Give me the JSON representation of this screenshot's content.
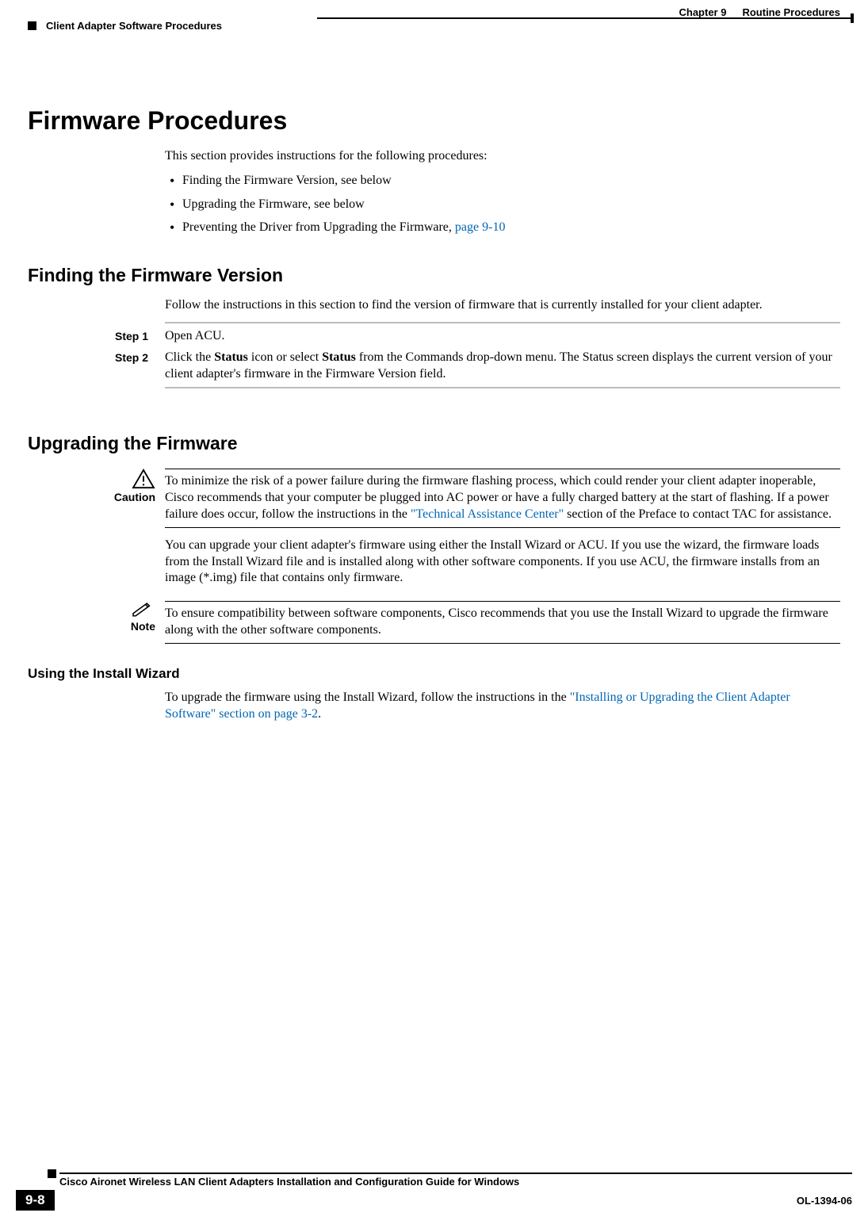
{
  "header": {
    "chapter": "Chapter 9",
    "title": "Routine Procedures",
    "section": "Client Adapter Software Procedures"
  },
  "main": {
    "h1": "Firmware Procedures",
    "intro": "This section provides instructions for the following procedures:",
    "bullets": [
      {
        "text": "Finding the Firmware Version, see below",
        "link": ""
      },
      {
        "text": "Upgrading the Firmware, see below",
        "link": ""
      },
      {
        "text": "Preventing the Driver from Upgrading the Firmware, ",
        "link": "page 9-10"
      }
    ],
    "finding": {
      "heading": "Finding the Firmware Version",
      "intro": "Follow the instructions in this section to find the version of firmware that is currently installed for your client adapter.",
      "steps": [
        {
          "label": "Step 1",
          "html": "Open ACU."
        },
        {
          "label": "Step 2",
          "html": "Click the <b>Status</b> icon or select <b>Status</b> from the Commands drop-down menu. The Status screen displays the current version of your client adapter's firmware in the Firmware Version field."
        }
      ]
    },
    "upgrading": {
      "heading": "Upgrading the Firmware",
      "caution_label": "Caution",
      "caution_text_before": "To minimize the risk of a power failure during the firmware flashing process, which could render your client adapter inoperable, Cisco recommends that your computer be plugged into AC power or have a fully charged battery at the start of flashing. If a power failure does occur, follow the instructions in the ",
      "caution_link": "\"Technical Assistance Center\"",
      "caution_text_after": " section of the Preface to contact TAC for assistance.",
      "para": "You can upgrade your client adapter's firmware using either the Install Wizard or ACU. If you use the wizard, the firmware loads from the Install Wizard file and is installed along with other software components. If you use ACU, the firmware installs from an image (*.img) file that contains only firmware.",
      "note_label": "Note",
      "note_text": "To ensure compatibility between software components, Cisco recommends that you use the Install Wizard to upgrade the firmware along with the other software components.",
      "using_wizard_heading": "Using the Install Wizard",
      "using_wizard_before": "To upgrade the firmware using the Install Wizard, follow the instructions in the ",
      "using_wizard_link": "\"Installing or Upgrading the Client Adapter Software\" section on page 3-2",
      "using_wizard_after": "."
    }
  },
  "footer": {
    "book": "Cisco Aironet Wireless LAN Client Adapters Installation and Configuration Guide for Windows",
    "page_num": "9-8",
    "doc_id": "OL-1394-06"
  }
}
